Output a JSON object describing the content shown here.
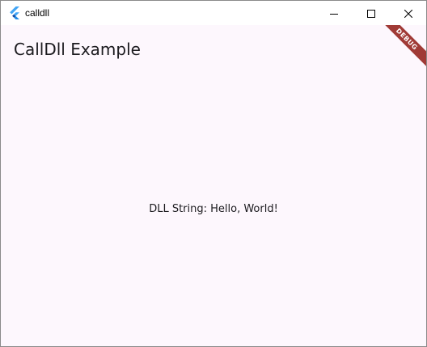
{
  "window": {
    "title": "calldll",
    "icon": "flutter-logo-icon",
    "controls": {
      "minimize_icon": "minimize-icon",
      "maximize_icon": "maximize-icon",
      "close_icon": "close-icon"
    }
  },
  "app": {
    "title": "CallDll Example",
    "dll_string": "DLL String: Hello, World!",
    "debug_banner": "DEBUG",
    "colors": {
      "background": "#fdf7fd",
      "text": "#1c1b1f",
      "banner": "#a03a36"
    }
  }
}
